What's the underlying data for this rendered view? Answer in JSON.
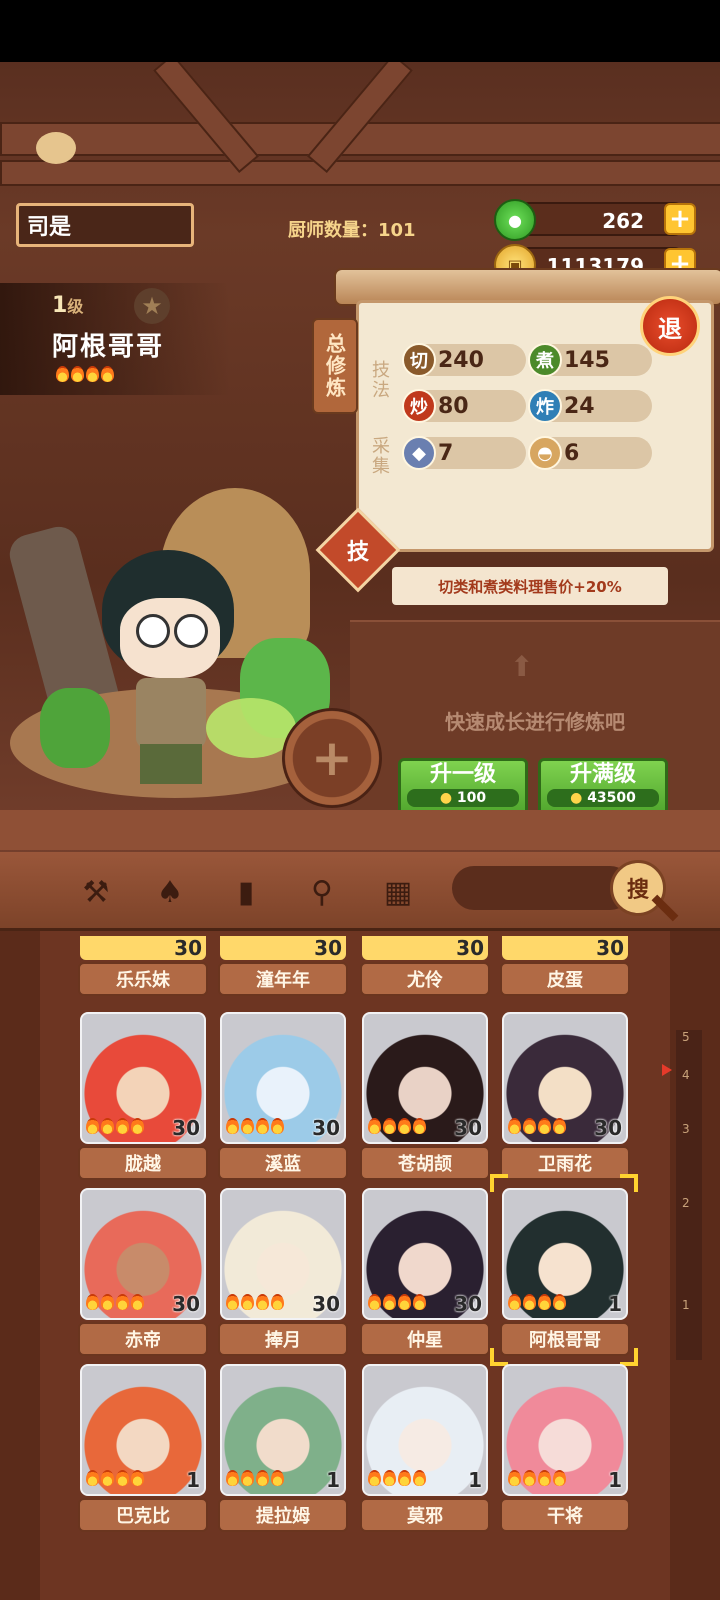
{
  "player": {
    "name": "司是"
  },
  "chef_count": {
    "label": "厨师数量：101"
  },
  "currency": {
    "jade": "262",
    "coins": "1113179"
  },
  "chef": {
    "level": "1",
    "level_unit": "级",
    "name": "阿根哥哥",
    "flames": 4
  },
  "panel": {
    "tag": "总修炼",
    "exit": "退",
    "technique_label": "技法",
    "gather_label": "采集",
    "stats": [
      {
        "icon": "切",
        "value": "240",
        "color": "#8a5a2b"
      },
      {
        "icon": "煮",
        "value": "145",
        "color": "#4c8a2a"
      },
      {
        "icon": "炒",
        "value": "80",
        "color": "#c0391c"
      },
      {
        "icon": "炸",
        "value": "24",
        "color": "#2f7fb6"
      },
      {
        "icon": "fish-icon",
        "value": "7",
        "color": "#6a7fb0"
      },
      {
        "icon": "bun-icon",
        "value": "6",
        "color": "#d7a660"
      }
    ],
    "skill_badge": "技",
    "skill_text": "切类和煮类料理售价+20%",
    "grow_text": "快速成长进行修炼吧",
    "upgrade_one": {
      "label": "升一级",
      "cost": "100"
    },
    "upgrade_max": {
      "label": "升满级",
      "cost": "43500"
    }
  },
  "toolbar": {
    "icons": [
      "shovel-icon",
      "spade-icon",
      "jar-icon",
      "location-pin-icon",
      "map-icon"
    ],
    "search_label": "搜"
  },
  "chef_list": {
    "top_row": [
      {
        "name": "乐乐妹",
        "level": "30"
      },
      {
        "name": "潼年年",
        "level": "30"
      },
      {
        "name": "尤伶",
        "level": "30"
      },
      {
        "name": "皮蛋",
        "level": "30"
      }
    ],
    "rows": [
      [
        {
          "name": "胧越",
          "level": "30",
          "color": "#e84a3a",
          "hair": "#f3d3b8"
        },
        {
          "name": "溪蓝",
          "level": "30",
          "color": "#9ccbe8",
          "hair": "#e9f2fb"
        },
        {
          "name": "苍胡颉",
          "level": "30",
          "color": "#2a1a1a",
          "hair": "#e9d2c6"
        },
        {
          "name": "卫雨花",
          "level": "30",
          "color": "#3a2a3a",
          "hair": "#f3dfc6"
        }
      ],
      [
        {
          "name": "赤帝",
          "level": "30",
          "color": "#e86a5a",
          "hair": "#c88b6a"
        },
        {
          "name": "捧月",
          "level": "30",
          "color": "#f2ead8",
          "hair": "#f6e8d8"
        },
        {
          "name": "仲星",
          "level": "30",
          "color": "#2a2030",
          "hair": "#f0d8cc"
        },
        {
          "name": "阿根哥哥",
          "level": "1",
          "color": "#222f2f",
          "hair": "#f6e2cf",
          "selected": true
        }
      ],
      [
        {
          "name": "巴克比",
          "level": "1",
          "color": "#e8683a",
          "hair": "#f3d8c2"
        },
        {
          "name": "提拉姆",
          "level": "1",
          "color": "#7fb08a",
          "hair": "#f1dccb"
        },
        {
          "name": "莫邪",
          "level": "1",
          "color": "#e8eef4",
          "hair": "#f6ebe4"
        },
        {
          "name": "干将",
          "level": "1",
          "color": "#f08a9a",
          "hair": "#f6dcd8"
        }
      ]
    ]
  },
  "ruler": {
    "ticks": [
      "5",
      "4",
      "3",
      "2",
      "1"
    ]
  }
}
